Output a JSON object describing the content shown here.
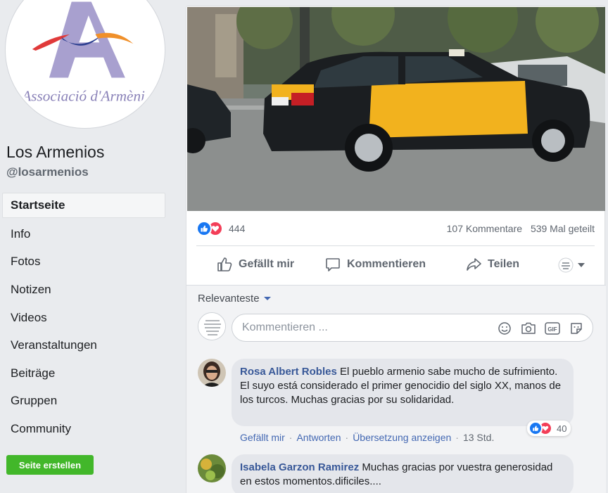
{
  "page": {
    "name": "Los Armenios",
    "handle": "@losarmenios",
    "logo_text": "Associació d'Armènia Catalunya -Arm"
  },
  "nav": {
    "items": [
      {
        "label": "Startseite",
        "active": true
      },
      {
        "label": "Info"
      },
      {
        "label": "Fotos"
      },
      {
        "label": "Notizen"
      },
      {
        "label": "Videos"
      },
      {
        "label": "Veranstaltungen"
      },
      {
        "label": "Beiträge"
      },
      {
        "label": "Gruppen"
      },
      {
        "label": "Community"
      }
    ],
    "create_button": "Seite erstellen"
  },
  "post": {
    "reaction_count": "444",
    "comments_count": "107 Kommentare",
    "shares_count": "539 Mal geteilt",
    "actions": {
      "like": "Gefällt mir",
      "comment": "Kommentieren",
      "share": "Teilen"
    }
  },
  "comments": {
    "sort_label": "Relevanteste",
    "composer_placeholder": "Kommentieren ...",
    "items": [
      {
        "author": "Rosa Albert Robles",
        "text": "El pueblo armenio sabe mucho de sufrimiento. El suyo está considerado el primer genocidio del siglo XX, manos de los turcos. Muchas gracias por su solidaridad.",
        "like": "Gefällt mir",
        "reply": "Antworten",
        "translate": "Übersetzung anzeigen",
        "time": "13 Std.",
        "reactions": "40"
      },
      {
        "author": "Isabela Garzon Ramirez",
        "text": "Muchas gracias por vuestra generosidad en estos momentos.dificiles...."
      }
    ]
  },
  "colors": {
    "like_blue": "#1877f2",
    "love_red": "#f33e58",
    "link_blue": "#385898",
    "create_green": "#42b72a"
  }
}
